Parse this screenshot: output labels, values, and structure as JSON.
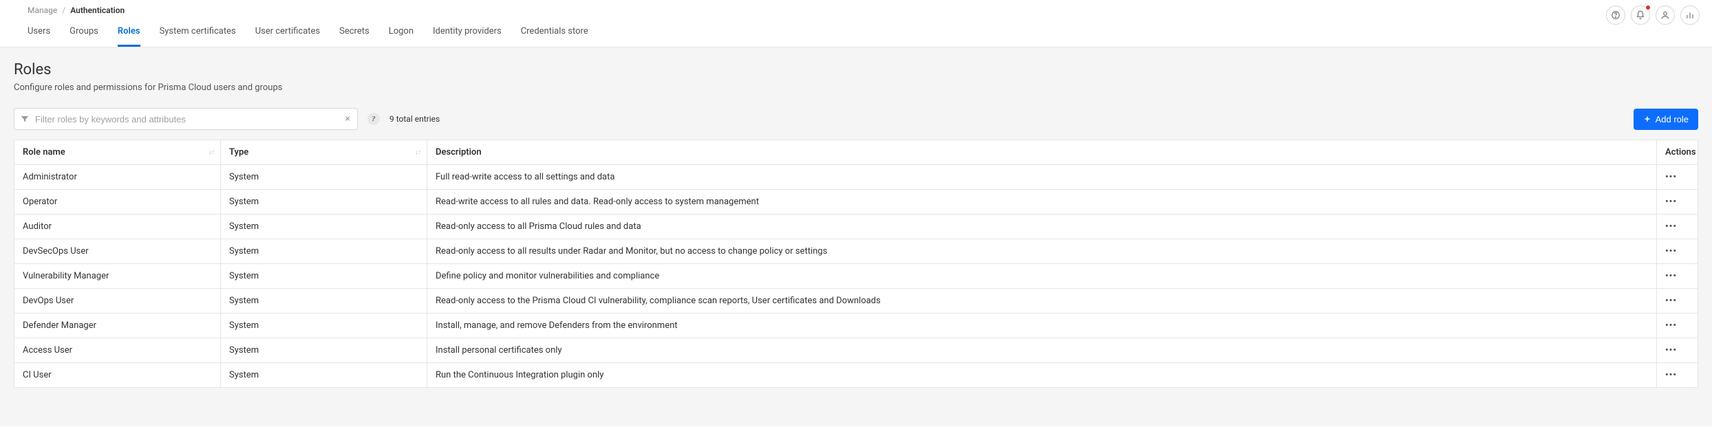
{
  "breadcrumb": {
    "root": "Manage",
    "current": "Authentication"
  },
  "tabs": [
    {
      "label": "Users",
      "active": false
    },
    {
      "label": "Groups",
      "active": false
    },
    {
      "label": "Roles",
      "active": true
    },
    {
      "label": "System certificates",
      "active": false
    },
    {
      "label": "User certificates",
      "active": false
    },
    {
      "label": "Secrets",
      "active": false
    },
    {
      "label": "Logon",
      "active": false
    },
    {
      "label": "Identity providers",
      "active": false
    },
    {
      "label": "Credentials store",
      "active": false
    }
  ],
  "header": {
    "title": "Roles",
    "subtitle": "Configure roles and permissions for Prisma Cloud users and groups"
  },
  "filter": {
    "placeholder": "Filter roles by keywords and attributes",
    "value": ""
  },
  "entries_text": "9 total entries",
  "add_button_label": "Add role",
  "columns": {
    "name": "Role name",
    "type": "Type",
    "description": "Description",
    "actions": "Actions"
  },
  "rows": [
    {
      "name": "Administrator",
      "type": "System",
      "description": "Full read-write access to all settings and data"
    },
    {
      "name": "Operator",
      "type": "System",
      "description": "Read-write access to all rules and data. Read-only access to system management"
    },
    {
      "name": "Auditor",
      "type": "System",
      "description": "Read-only access to all Prisma Cloud rules and data"
    },
    {
      "name": "DevSecOps User",
      "type": "System",
      "description": "Read-only access to all results under Radar and Monitor, but no access to change policy or settings"
    },
    {
      "name": "Vulnerability Manager",
      "type": "System",
      "description": "Define policy and monitor vulnerabilities and compliance"
    },
    {
      "name": "DevOps User",
      "type": "System",
      "description": "Read-only access to the Prisma Cloud CI vulnerability, compliance scan reports, User certificates and Downloads"
    },
    {
      "name": "Defender Manager",
      "type": "System",
      "description": "Install, manage, and remove Defenders from the environment"
    },
    {
      "name": "Access User",
      "type": "System",
      "description": "Install personal certificates only"
    },
    {
      "name": "CI User",
      "type": "System",
      "description": "Run the Continuous Integration plugin only"
    }
  ],
  "colors": {
    "accent": "#0d6efd",
    "tab_active": "#0a6ed1",
    "notif": "#d93025"
  }
}
